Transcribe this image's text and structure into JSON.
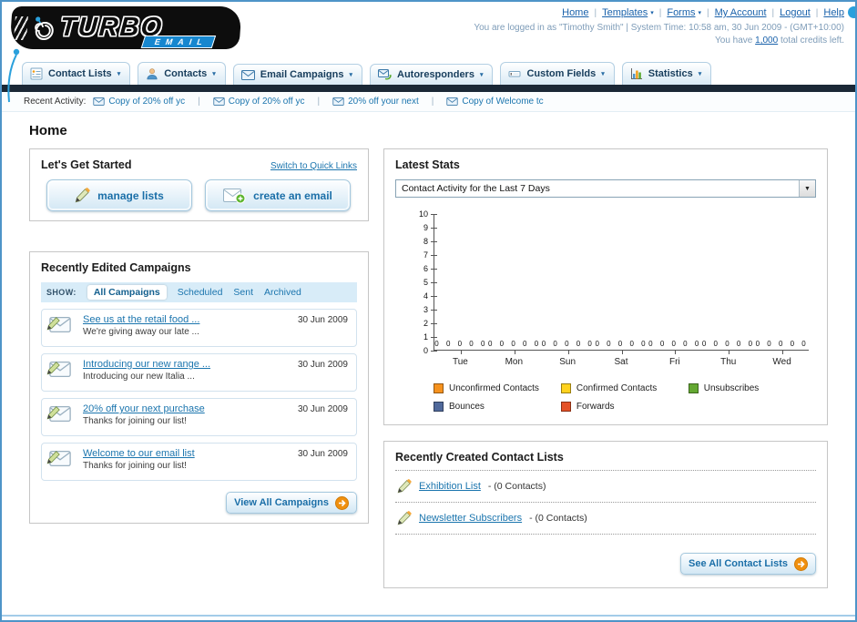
{
  "brand": {
    "name": "TURBO",
    "sub": "EMAIL"
  },
  "icons": {
    "chevron_down": "▾",
    "select_caret": "▼"
  },
  "header": {
    "links": [
      {
        "label": "Home"
      },
      {
        "label": "Templates"
      },
      {
        "label": "Forms"
      },
      {
        "label": "My Account"
      },
      {
        "label": "Logout"
      },
      {
        "label": "Help"
      }
    ],
    "login_info": "You are logged in as \"Timothy Smith\" | System Time: 10:58 am, 30 Jun 2009 - (GMT+10:00)",
    "credits_prefix": "You have",
    "credits_value": "1,000",
    "credits_suffix": "total credits left."
  },
  "nav": {
    "tabs": [
      {
        "label": "Contact Lists"
      },
      {
        "label": "Contacts"
      },
      {
        "label": "Email Campaigns"
      },
      {
        "label": "Autoresponders"
      },
      {
        "label": "Custom Fields"
      },
      {
        "label": "Statistics"
      }
    ]
  },
  "recent_activity": {
    "label": "Recent Activity:",
    "items": [
      {
        "label": "Copy of 20% off yc"
      },
      {
        "label": "Copy of 20% off yc"
      },
      {
        "label": "20% off your next"
      },
      {
        "label": "Copy of Welcome tc"
      }
    ]
  },
  "page": {
    "title": "Home"
  },
  "get_started": {
    "title": "Let's Get Started",
    "switch_link": "Switch to Quick Links",
    "manage_lists_label": "manage lists",
    "create_email_label": "create an email"
  },
  "campaigns": {
    "title": "Recently Edited Campaigns",
    "show_label": "SHOW:",
    "tabs": [
      {
        "label": "All Campaigns",
        "active": true
      },
      {
        "label": "Scheduled"
      },
      {
        "label": "Sent"
      },
      {
        "label": "Archived"
      }
    ],
    "items": [
      {
        "title": "See us at the retail food ...",
        "subtitle": "We're giving away our late ...",
        "date": "30 Jun 2009"
      },
      {
        "title": "Introducing our new range ...",
        "subtitle": "Introducing our new Italia ...",
        "date": "30 Jun 2009"
      },
      {
        "title": "20% off your next purchase",
        "subtitle": "Thanks for joining our list!",
        "date": "30 Jun 2009"
      },
      {
        "title": "Welcome to our email list",
        "subtitle": "Thanks for joining our list!",
        "date": "30 Jun 2009"
      }
    ],
    "view_all_label": "View All Campaigns"
  },
  "stats": {
    "title": "Latest Stats",
    "dropdown_value": "Contact Activity for the Last 7 Days",
    "chart_data": {
      "type": "bar",
      "categories": [
        "Tue",
        "Mon",
        "Sun",
        "Sat",
        "Fri",
        "Thu",
        "Wed"
      ],
      "series": [
        {
          "name": "Unconfirmed Contacts",
          "color": "#f6921e",
          "values": [
            0,
            0,
            0,
            0,
            0,
            0,
            0
          ]
        },
        {
          "name": "Confirmed Contacts",
          "color": "#ffd21e",
          "values": [
            0,
            0,
            0,
            0,
            0,
            0,
            0
          ]
        },
        {
          "name": "Unsubscribes",
          "color": "#64a832",
          "values": [
            0,
            0,
            0,
            0,
            0,
            0,
            0
          ]
        },
        {
          "name": "Bounces",
          "color": "#50699b",
          "values": [
            0,
            0,
            0,
            0,
            0,
            0,
            0
          ]
        },
        {
          "name": "Forwards",
          "color": "#e45126",
          "values": [
            0,
            0,
            0,
            0,
            0,
            0,
            0
          ]
        }
      ],
      "title": "Contact Activity for the Last 7 Days",
      "xlabel": "",
      "ylabel": "",
      "ylim": [
        0,
        10
      ],
      "yticks": [
        0,
        1,
        2,
        3,
        4,
        5,
        6,
        7,
        8,
        9,
        10
      ],
      "grid": false,
      "legend_position": "bottom"
    }
  },
  "contact_lists": {
    "title": "Recently Created Contact Lists",
    "items": [
      {
        "name": "Exhibition List",
        "detail": "- (0 Contacts)"
      },
      {
        "name": "Newsletter Subscribers",
        "detail": "- (0 Contacts)"
      }
    ],
    "see_all_label": "See All Contact Lists"
  }
}
